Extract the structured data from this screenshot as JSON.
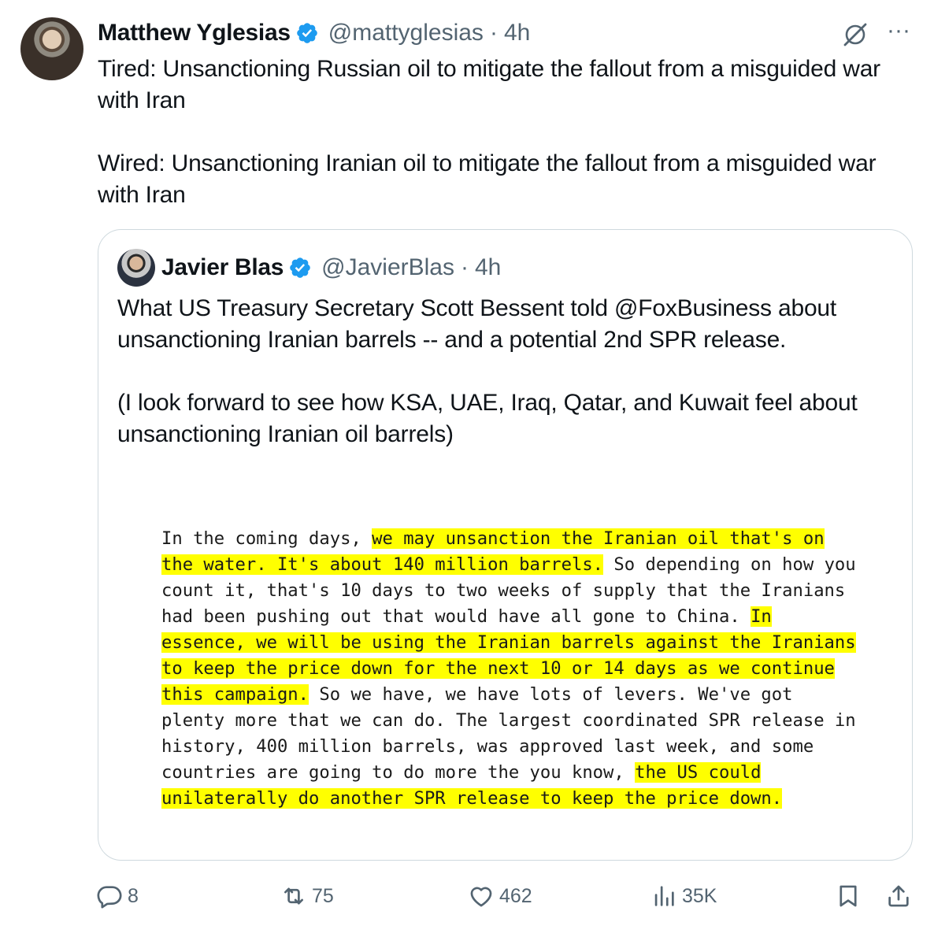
{
  "author": {
    "name": "Matthew Yglesias",
    "handle": "@mattyglesias",
    "separator": "·",
    "time": "4h",
    "text": "Tired: Unsanctioning Russian oil to mitigate the fallout from a misguided war with Iran\n\nWired: Unsanctioning Iranian oil to mitigate the fallout from a misguided war with Iran"
  },
  "header_icons": {
    "grok": "grok-icon",
    "more_label": "···"
  },
  "quote": {
    "name": "Javier Blas",
    "handle": "@JavierBlas",
    "separator": "·",
    "time": "4h",
    "text": "What US Treasury Secretary Scott Bessent told @FoxBusiness about unsanctioning Iranian barrels -- and a potential 2nd SPR release.\n\n(I look forward to see how KSA, UAE, Iraq, Qatar, and Kuwait feel about unsanctioning Iranian oil barrels)",
    "document_lines": [
      [
        {
          "t": "In the coming days, ",
          "h": false
        },
        {
          "t": "we may unsanction the Iranian oil that's on",
          "h": true
        }
      ],
      [
        {
          "t": "the water. It's about 140 million barrels.",
          "h": true
        },
        {
          "t": " So depending on how you",
          "h": false
        }
      ],
      [
        {
          "t": "count it, that's 10 days to two weeks of supply that the Iranians",
          "h": false
        }
      ],
      [
        {
          "t": "had been pushing out that would have all gone to China. ",
          "h": false
        },
        {
          "t": "In",
          "h": true
        }
      ],
      [
        {
          "t": "essence, we will be using the Iranian barrels against the Iranians",
          "h": true
        }
      ],
      [
        {
          "t": "to keep the price down for the next 10 or 14 days as we continue",
          "h": true
        }
      ],
      [
        {
          "t": "this campaign.",
          "h": true
        },
        {
          "t": " So we have, we have lots of levers. We've got",
          "h": false
        }
      ],
      [
        {
          "t": "plenty more that we can do. The largest coordinated SPR release in",
          "h": false
        }
      ],
      [
        {
          "t": "history, 400 million barrels, was approved last week, and some",
          "h": false
        }
      ],
      [
        {
          "t": "countries are going to do more the you know, ",
          "h": false
        },
        {
          "t": "the US could",
          "h": true
        }
      ],
      [
        {
          "t": "unilaterally do another SPR release to keep the price down.",
          "h": true
        }
      ]
    ],
    "highlight_color": "#ffff00"
  },
  "actions": {
    "replies": "8",
    "reposts": "75",
    "likes": "462",
    "views": "35K"
  },
  "colors": {
    "verified": "#1d9bf0",
    "muted": "#536471",
    "border": "#cfd9de"
  }
}
